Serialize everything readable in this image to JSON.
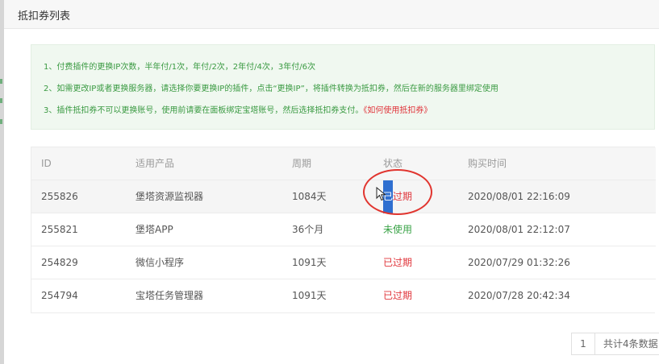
{
  "dialog": {
    "title": "抵扣券列表"
  },
  "notice": {
    "lines": [
      "1、付费插件的更换IP次数，半年付/1次，年付/2次，2年付/4次，3年付/6次",
      "2、如需更改IP或者更换服务器，请选择你要更换IP的插件，点击“更换IP”，将插件转换为抵扣券，然后在新的服务器里绑定使用",
      "3、插件抵扣券不可以更换账号，使用前请要在面板绑定宝塔账号，然后选择抵扣券支付。"
    ],
    "link": "《如何使用抵扣券》"
  },
  "table": {
    "headers": [
      "ID",
      "适用产品",
      "周期",
      "状态",
      "购买时间"
    ],
    "rows": [
      {
        "id": "255826",
        "product": "堡塔资源监视器",
        "period": "1084天",
        "status_sel": "已",
        "status": "过期",
        "time": "2020/08/01 22:16:09"
      },
      {
        "id": "255821",
        "product": "堡塔APP",
        "period": "36个月",
        "status": "未使用",
        "time": "2020/08/01 22:12:07"
      },
      {
        "id": "254829",
        "product": "微信小程序",
        "period": "1091天",
        "status": "已过期",
        "time": "2020/07/29 01:32:26"
      },
      {
        "id": "254794",
        "product": "宝塔任务管理器",
        "period": "1091天",
        "status": "已过期",
        "time": "2020/07/28 20:42:34"
      }
    ]
  },
  "pager": {
    "current": "1",
    "total": "共计4条数据"
  },
  "colors": {
    "expired": "#e0353b",
    "unused": "#3aa347",
    "notice_text": "#3a9a42",
    "annotation_circle": "#e1352f"
  },
  "icons": {
    "pointer": "mouse-pointer-icon"
  }
}
